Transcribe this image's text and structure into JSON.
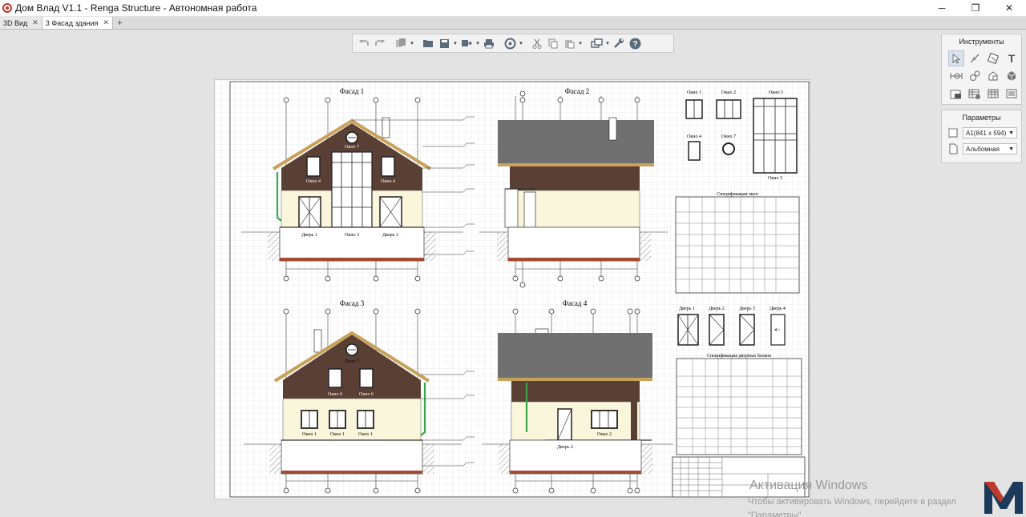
{
  "window": {
    "title": "Дом Влад V1.1 - Renga Structure - Автономная работа",
    "minimize": "─",
    "maximize": "❐",
    "close": "✕"
  },
  "tabs": [
    {
      "label": "3D Вид",
      "close": "✕",
      "active": false
    },
    {
      "label": "3 Фасад здания",
      "close": "✕",
      "active": true
    }
  ],
  "tab_add": "+",
  "toolbar": {
    "icons": [
      "undo-icon",
      "redo-icon",
      "copy-views-icon",
      "open-icon",
      "save-icon",
      "export-icon",
      "print-icon",
      "sync-icon",
      "cut-icon",
      "copy-icon",
      "paste-icon",
      "view-layers-icon",
      "settings-wrench-icon",
      "help-icon"
    ],
    "help": "?"
  },
  "drawing": {
    "facade1_title": "Фасад 1",
    "facade2_title": "Фасад 2",
    "facade3_title": "Фасад 3",
    "facade4_title": "Фасад 4",
    "f1_window_top": "Окно 7",
    "f1_window_left": "Окно 4",
    "f1_window_right": "Окно 4",
    "f1_door_left": "Дверь 1",
    "f1_window_center": "Окно 3",
    "f1_door_right": "Дверь 1",
    "f3_window_top": "Окно 7",
    "f3_window_6a": "Окно 6",
    "f3_window_6b": "Окно 6",
    "f3_window_1a": "Окно 1",
    "f3_window_1b": "Окно 1",
    "f3_window_1c": "Окно 1",
    "f4_window": "Окно 2",
    "f4_door": "Дверь 2",
    "win_label_1": "Окно 1",
    "win_label_2": "Окно 2",
    "win_label_5": "Окно 5",
    "win_label_4": "Окно 4",
    "win_label_7": "Окно 7",
    "win_label_3": "Окно 3",
    "window_spec_title": "Спецификация окон",
    "door_label_1": "Дверь 1",
    "door_label_2": "Дверь 2",
    "door_label_3": "Дверь 3",
    "door_label_4": "Дверь 4",
    "door_spec_title": "Спецификация дверных блоков"
  },
  "tools_panel": {
    "title": "Инструменты",
    "tools": [
      "select-cursor-icon",
      "line-tool-icon",
      "fill-tool-icon",
      "text-tool-icon",
      "dimension-tool-icon",
      "level-mark-icon",
      "view-3d-icon",
      "box-icon",
      "stamp-a1-icon",
      "table-icon",
      "grid-table-icon",
      "list-icon"
    ],
    "text_tool": "T"
  },
  "params_panel": {
    "title": "Параметры",
    "format_value": "А1(841 х 594)",
    "orientation_value": "Альбомная"
  },
  "watermark": {
    "title": "Активация Windows",
    "line1": "Чтобы активировать Windows, перейдите в раздел",
    "line2": "\"Параметры\""
  },
  "colors": {
    "roof_dark": "#5c3a2c",
    "roof_trim": "#c8a25a",
    "wall_brown": "#5a3f35",
    "wall_cream": "#faf6dc",
    "foundation": "#a24a32",
    "grey_roof": "#707070",
    "grid_line": "#dcdcdc"
  }
}
